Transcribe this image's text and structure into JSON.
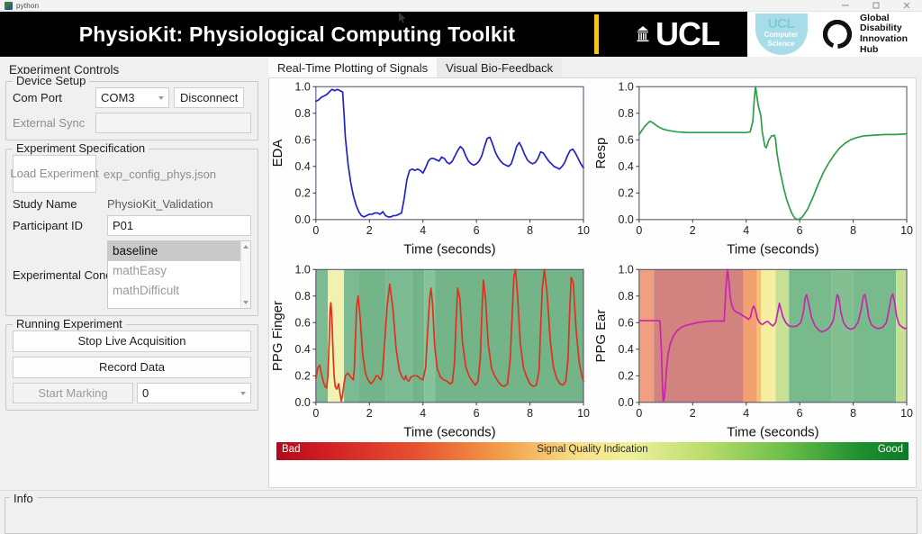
{
  "window": {
    "os_title": "python",
    "controls": [
      "minimize",
      "maximize",
      "close"
    ]
  },
  "header": {
    "title": "PhysioKit: Physiological Computing Toolkit",
    "accent_stripe": "#f5c518",
    "background": "#000000",
    "logos": [
      {
        "name": "ucl-logo",
        "text": "UCL"
      },
      {
        "name": "ucl-computer-science-logo",
        "line1": "Computer",
        "line2": "Science",
        "mark": "UCL"
      },
      {
        "name": "global-disability-innovation-hub-logo",
        "lines": [
          "Global",
          "Disability",
          "Innovation",
          "Hub"
        ]
      }
    ]
  },
  "sidebar": {
    "title": "Experiment Controls",
    "device_setup": {
      "legend": "Device Setup",
      "com_port_label": "Com Port",
      "com_port_value": "COM3",
      "com_port_options": [
        "COM3"
      ],
      "disconnect_label": "Disconnect",
      "external_sync_label": "External Sync",
      "external_sync_value": ""
    },
    "experiment_spec": {
      "legend": "Experiment Specification",
      "load_button_label": "Load Experiment",
      "config_file": "exp_config_phys.json",
      "study_name_label": "Study Name",
      "study_name_value": "PhysioKit_Validation",
      "participant_id_label": "Participant ID",
      "participant_id_value": "P01",
      "conditions_label": "Experimental Conditions",
      "conditions": [
        {
          "label": "baseline",
          "selected": true
        },
        {
          "label": "mathEasy",
          "selected": false
        },
        {
          "label": "mathDifficult",
          "selected": false
        }
      ]
    },
    "running_experiment": {
      "legend": "Running Experiment",
      "stop_label": "Stop Live Acquisition",
      "record_label": "Record Data",
      "marking_label": "Start Marking",
      "marking_value": "0",
      "marking_options": [
        "0"
      ]
    }
  },
  "main": {
    "tabs": [
      {
        "label": "Real-Time Plotting of Signals",
        "active": true
      },
      {
        "label": "Visual Bio-Feedback",
        "active": false
      }
    ],
    "signal_quality": {
      "bad_label": "Bad",
      "title": "Signal Quality Indication",
      "good_label": "Good"
    }
  },
  "statusbar": {
    "legend": "Info",
    "text": ""
  },
  "chart_data": [
    {
      "id": "eda",
      "type": "line",
      "ylabel": "EDA",
      "xlabel": "Time (seconds)",
      "xlim": [
        0,
        10
      ],
      "ylim": [
        0,
        1
      ],
      "xticks": [
        0,
        2,
        4,
        6,
        8,
        10
      ],
      "yticks": [
        "0.0",
        "0.2",
        "0.4",
        "0.6",
        "0.8",
        "1.0"
      ],
      "grid": false,
      "color": "#2222cc",
      "bands": [],
      "x": [
        0,
        0.1,
        0.2,
        0.3,
        0.4,
        0.5,
        0.6,
        0.7,
        0.8,
        0.9,
        1.0,
        1.05,
        1.1,
        1.2,
        1.3,
        1.4,
        1.5,
        1.6,
        1.7,
        1.8,
        1.9,
        2.0,
        2.1,
        2.2,
        2.3,
        2.4,
        2.5,
        2.6,
        2.7,
        2.8,
        2.9,
        3.0,
        3.1,
        3.2,
        3.3,
        3.4,
        3.5,
        3.6,
        3.7,
        3.8,
        3.9,
        4.0,
        4.1,
        4.2,
        4.3,
        4.4,
        4.5,
        4.6,
        4.7,
        4.8,
        4.9,
        5.0,
        5.1,
        5.2,
        5.3,
        5.4,
        5.5,
        5.6,
        5.7,
        5.8,
        5.9,
        6.0,
        6.1,
        6.2,
        6.3,
        6.4,
        6.5,
        6.6,
        6.7,
        6.8,
        6.9,
        7.0,
        7.1,
        7.2,
        7.3,
        7.4,
        7.5,
        7.6,
        7.7,
        7.8,
        7.9,
        8.0,
        8.1,
        8.2,
        8.3,
        8.4,
        8.5,
        8.6,
        8.7,
        8.8,
        8.9,
        9.0,
        9.1,
        9.2,
        9.3,
        9.4,
        9.5,
        9.6,
        9.7,
        9.8,
        9.9,
        10.0
      ],
      "y": [
        0.89,
        0.9,
        0.92,
        0.93,
        0.94,
        0.96,
        0.98,
        0.97,
        0.98,
        0.97,
        0.96,
        0.8,
        0.62,
        0.42,
        0.28,
        0.18,
        0.11,
        0.06,
        0.03,
        0.02,
        0.03,
        0.04,
        0.04,
        0.05,
        0.05,
        0.04,
        0.06,
        0.03,
        0.02,
        0.02,
        0.03,
        0.03,
        0.04,
        0.05,
        0.16,
        0.3,
        0.37,
        0.38,
        0.37,
        0.38,
        0.37,
        0.35,
        0.39,
        0.44,
        0.46,
        0.46,
        0.45,
        0.44,
        0.47,
        0.46,
        0.43,
        0.42,
        0.44,
        0.48,
        0.52,
        0.55,
        0.53,
        0.48,
        0.44,
        0.42,
        0.41,
        0.42,
        0.44,
        0.48,
        0.55,
        0.61,
        0.62,
        0.57,
        0.51,
        0.47,
        0.44,
        0.42,
        0.41,
        0.4,
        0.42,
        0.48,
        0.55,
        0.58,
        0.54,
        0.49,
        0.45,
        0.43,
        0.42,
        0.43,
        0.46,
        0.51,
        0.5,
        0.47,
        0.44,
        0.42,
        0.4,
        0.39,
        0.38,
        0.4,
        0.43,
        0.48,
        0.52,
        0.53,
        0.5,
        0.46,
        0.42,
        0.39
      ]
    },
    {
      "id": "resp",
      "type": "line",
      "ylabel": "Resp",
      "xlabel": "Time (seconds)",
      "xlim": [
        0,
        10
      ],
      "ylim": [
        0,
        1
      ],
      "xticks": [
        0,
        2,
        4,
        6,
        8,
        10
      ],
      "yticks": [
        "0.0",
        "0.2",
        "0.4",
        "0.6",
        "0.8",
        "1.0"
      ],
      "grid": false,
      "color": "#2e9e48",
      "bands": [],
      "x": [
        0,
        0.2,
        0.4,
        0.5,
        0.7,
        0.9,
        1.1,
        1.4,
        1.8,
        2.2,
        2.6,
        3.0,
        3.4,
        3.8,
        4.0,
        4.15,
        4.25,
        4.3,
        4.35,
        4.45,
        4.55,
        4.6,
        4.7,
        4.75,
        4.85,
        4.95,
        5.0,
        5.05,
        5.1,
        5.15,
        5.25,
        5.4,
        5.5,
        5.6,
        5.7,
        5.8,
        5.9,
        6.0,
        6.1,
        6.3,
        6.5,
        6.7,
        6.9,
        7.1,
        7.3,
        7.5,
        7.7,
        7.9,
        8.1,
        8.4,
        8.8,
        9.2,
        9.6,
        10.0
      ],
      "y": [
        0.64,
        0.7,
        0.74,
        0.73,
        0.7,
        0.68,
        0.67,
        0.66,
        0.655,
        0.655,
        0.655,
        0.655,
        0.655,
        0.655,
        0.655,
        0.66,
        0.74,
        0.9,
        1.0,
        0.86,
        0.78,
        0.66,
        0.55,
        0.54,
        0.6,
        0.63,
        0.63,
        0.635,
        0.6,
        0.5,
        0.38,
        0.24,
        0.16,
        0.1,
        0.05,
        0.015,
        0.0,
        0.005,
        0.02,
        0.08,
        0.17,
        0.27,
        0.36,
        0.43,
        0.49,
        0.54,
        0.575,
        0.6,
        0.615,
        0.63,
        0.635,
        0.64,
        0.64,
        0.645
      ]
    },
    {
      "id": "ppg_finger",
      "type": "line",
      "ylabel": "PPG Finger",
      "xlabel": "Time (seconds)",
      "xlim": [
        0,
        10
      ],
      "ylim": [
        0,
        1
      ],
      "xticks": [
        0,
        2,
        4,
        6,
        8,
        10
      ],
      "yticks": [
        "0.0",
        "0.2",
        "0.4",
        "0.6",
        "0.8",
        "1.0"
      ],
      "grid": false,
      "color": "#e03020",
      "bands": [
        {
          "from": 0.0,
          "to": 0.45,
          "color": "#7cba92"
        },
        {
          "from": 0.45,
          "to": 1.05,
          "color": "#f2f2b0"
        },
        {
          "from": 1.05,
          "to": 1.6,
          "color": "#7cba92"
        },
        {
          "from": 1.6,
          "to": 2.6,
          "color": "#73b489"
        },
        {
          "from": 2.6,
          "to": 3.6,
          "color": "#7cba92"
        },
        {
          "from": 3.6,
          "to": 4.05,
          "color": "#73b489"
        },
        {
          "from": 4.05,
          "to": 4.45,
          "color": "#86c29a"
        },
        {
          "from": 4.45,
          "to": 10.0,
          "color": "#73b489"
        }
      ],
      "x": [
        0,
        0.07,
        0.14,
        0.2,
        0.27,
        0.34,
        0.4,
        0.45,
        0.5,
        0.53,
        0.56,
        0.6,
        0.64,
        0.68,
        0.72,
        0.78,
        0.85,
        0.9,
        0.95,
        1.0,
        1.05,
        1.1,
        1.2,
        1.3,
        1.4,
        1.44,
        1.48,
        1.52,
        1.58,
        1.66,
        1.75,
        1.85,
        1.95,
        2.05,
        2.15,
        2.25,
        2.32,
        2.37,
        2.42,
        2.48,
        2.56,
        2.66,
        2.76,
        2.88,
        3.0,
        3.12,
        3.22,
        3.3,
        3.36,
        3.41,
        3.47,
        3.55,
        3.65,
        3.78,
        3.9,
        4.0,
        4.1,
        4.18,
        4.25,
        4.3,
        4.36,
        4.44,
        4.54,
        4.66,
        4.78,
        4.9,
        5.0,
        5.1,
        5.18,
        5.24,
        5.3,
        5.38,
        5.48,
        5.6,
        5.72,
        5.84,
        5.96,
        6.06,
        6.14,
        6.2,
        6.26,
        6.34,
        6.44,
        6.56,
        6.68,
        6.8,
        6.92,
        7.04,
        7.16,
        7.26,
        7.34,
        7.4,
        7.46,
        7.54,
        7.64,
        7.76,
        7.88,
        8.0,
        8.12,
        8.24,
        8.34,
        8.4,
        8.46,
        8.54,
        8.64,
        8.76,
        8.88,
        9.0,
        9.12,
        9.24,
        9.34,
        9.42,
        9.48,
        9.54,
        9.62,
        9.72,
        9.84,
        9.94,
        10.0
      ],
      "y": [
        0.18,
        0.26,
        0.28,
        0.22,
        0.16,
        0.12,
        0.11,
        0.2,
        0.48,
        0.7,
        0.75,
        0.62,
        0.38,
        0.2,
        0.12,
        0.1,
        0.14,
        0.07,
        0.01,
        0.06,
        0.14,
        0.2,
        0.22,
        0.19,
        0.17,
        0.26,
        0.5,
        0.72,
        0.8,
        0.62,
        0.36,
        0.22,
        0.17,
        0.14,
        0.16,
        0.2,
        0.2,
        0.18,
        0.17,
        0.21,
        0.42,
        0.72,
        0.89,
        0.7,
        0.4,
        0.24,
        0.19,
        0.17,
        0.2,
        0.17,
        0.16,
        0.19,
        0.2,
        0.2,
        0.18,
        0.17,
        0.26,
        0.55,
        0.78,
        0.86,
        0.74,
        0.42,
        0.25,
        0.19,
        0.17,
        0.16,
        0.14,
        0.15,
        0.3,
        0.62,
        0.86,
        0.78,
        0.45,
        0.27,
        0.2,
        0.16,
        0.13,
        0.16,
        0.32,
        0.66,
        0.92,
        0.78,
        0.44,
        0.26,
        0.2,
        0.16,
        0.13,
        0.12,
        0.14,
        0.32,
        0.68,
        0.95,
        1.0,
        0.8,
        0.44,
        0.26,
        0.19,
        0.14,
        0.12,
        0.13,
        0.24,
        0.56,
        0.86,
        1.0,
        0.82,
        0.46,
        0.26,
        0.18,
        0.14,
        0.13,
        0.16,
        0.32,
        0.66,
        0.94,
        0.9,
        0.56,
        0.3,
        0.2,
        0.16,
        0.12,
        0.1,
        0.13,
        0.18,
        0.16
      ]
    },
    {
      "id": "ppg_ear",
      "type": "line",
      "ylabel": "PPG Ear",
      "xlabel": "Time (seconds)",
      "xlim": [
        0,
        10
      ],
      "ylim": [
        0,
        1
      ],
      "xticks": [
        0,
        2,
        4,
        6,
        8,
        10
      ],
      "yticks": [
        "0.0",
        "0.2",
        "0.4",
        "0.6",
        "0.8",
        "1.0"
      ],
      "grid": false,
      "color": "#c724b1",
      "bands": [
        {
          "from": 0.0,
          "to": 0.55,
          "color": "#f0a080"
        },
        {
          "from": 0.55,
          "to": 3.9,
          "color": "#d2837f"
        },
        {
          "from": 3.9,
          "to": 4.4,
          "color": "#f2a070"
        },
        {
          "from": 4.4,
          "to": 4.55,
          "color": "#f6c272"
        },
        {
          "from": 4.55,
          "to": 5.1,
          "color": "#f6eea0"
        },
        {
          "from": 5.1,
          "to": 5.6,
          "color": "#c8e094"
        },
        {
          "from": 5.6,
          "to": 7.2,
          "color": "#79ba8c"
        },
        {
          "from": 7.2,
          "to": 8.0,
          "color": "#84bf92"
        },
        {
          "from": 8.0,
          "to": 9.6,
          "color": "#79ba8c"
        },
        {
          "from": 9.6,
          "to": 10.0,
          "color": "#c8e094"
        }
      ],
      "x": [
        0,
        0.2,
        0.4,
        0.55,
        0.65,
        0.72,
        0.78,
        0.83,
        0.87,
        0.9,
        0.94,
        0.98,
        1.02,
        1.08,
        1.16,
        1.28,
        1.42,
        1.58,
        1.76,
        1.96,
        2.16,
        2.36,
        2.56,
        2.8,
        3.0,
        3.1,
        3.18,
        3.2,
        3.25,
        3.3,
        3.35,
        3.4,
        3.45,
        3.52,
        3.62,
        3.74,
        3.86,
        3.98,
        4.08,
        4.16,
        4.22,
        4.28,
        4.34,
        4.42,
        4.5,
        4.6,
        4.7,
        4.8,
        4.9,
        5.0,
        5.1,
        5.18,
        5.24,
        5.3,
        5.38,
        5.48,
        5.6,
        5.74,
        5.9,
        6.04,
        6.14,
        6.2,
        6.26,
        6.34,
        6.44,
        6.56,
        6.7,
        6.84,
        7.0,
        7.14,
        7.26,
        7.34,
        7.4,
        7.46,
        7.54,
        7.64,
        7.76,
        7.9,
        8.04,
        8.18,
        8.3,
        8.38,
        8.44,
        8.5,
        8.58,
        8.68,
        8.8,
        8.94,
        9.1,
        9.24,
        9.34,
        9.42,
        9.48,
        9.54,
        9.62,
        9.72,
        9.84,
        9.94,
        10.0
      ],
      "y": [
        0.615,
        0.615,
        0.615,
        0.615,
        0.615,
        0.615,
        0.61,
        0.4,
        0.14,
        0.01,
        0.03,
        0.12,
        0.24,
        0.36,
        0.44,
        0.5,
        0.54,
        0.565,
        0.58,
        0.59,
        0.6,
        0.605,
        0.61,
        0.612,
        0.612,
        0.612,
        0.612,
        0.7,
        0.88,
        1.0,
        0.92,
        0.8,
        0.74,
        0.7,
        0.68,
        0.67,
        0.655,
        0.64,
        0.625,
        0.64,
        0.7,
        0.725,
        0.7,
        0.63,
        0.6,
        0.585,
        0.6,
        0.61,
        0.59,
        0.575,
        0.6,
        0.68,
        0.745,
        0.7,
        0.64,
        0.6,
        0.575,
        0.57,
        0.575,
        0.6,
        0.68,
        0.78,
        0.81,
        0.74,
        0.64,
        0.58,
        0.545,
        0.53,
        0.545,
        0.57,
        0.62,
        0.72,
        0.81,
        0.79,
        0.68,
        0.6,
        0.565,
        0.55,
        0.56,
        0.6,
        0.7,
        0.8,
        0.81,
        0.75,
        0.64,
        0.585,
        0.565,
        0.555,
        0.565,
        0.6,
        0.7,
        0.79,
        0.815,
        0.76,
        0.65,
        0.585,
        0.565,
        0.555,
        0.56
      ]
    }
  ]
}
